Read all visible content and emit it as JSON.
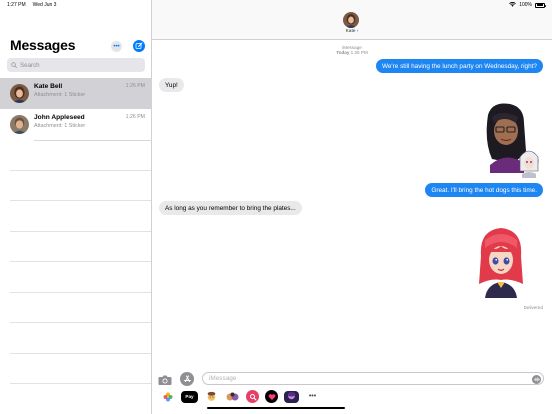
{
  "status_bar": {
    "time": "1:27 PM",
    "date": "Wed Jun 3",
    "battery": "100%"
  },
  "sidebar": {
    "title": "Messages",
    "more_symbol": "•••",
    "search_placeholder": "Search",
    "conversations": [
      {
        "name": "Kate Bell",
        "time": "1:26 PM",
        "preview": "Attachment: 1 Sticker",
        "selected": true
      },
      {
        "name": "John Appleseed",
        "time": "1:26 PM",
        "preview": "Attachment: 1 Sticker",
        "selected": false
      }
    ]
  },
  "chat": {
    "contact_name": "Kate",
    "contact_chevron": "›",
    "service": "iMessage",
    "day": "Today",
    "time": "1:25 PM",
    "messages": [
      {
        "from": "me",
        "kind": "text",
        "text": "We're still having the lunch party on Wednesday, right?"
      },
      {
        "from": "them",
        "kind": "text",
        "text": "Yup!"
      },
      {
        "from": "me",
        "kind": "sticker",
        "sticker": "dark-hair-girl-with-glasses-sticker"
      },
      {
        "from": "me",
        "kind": "text",
        "text": "Great. I'll bring the hot dogs this time."
      },
      {
        "from": "them",
        "kind": "text",
        "text": "As long as you remember to bring the plates..."
      },
      {
        "from": "me",
        "kind": "sticker",
        "sticker": "red-hair-girl-sticker"
      }
    ],
    "delivered_label": "Delivered",
    "input_placeholder": "iMessage"
  },
  "app_strip": {
    "apps": [
      "photos-app-icon",
      "apple-pay-app-icon",
      "memoji-app-icon",
      "memoji-stickers-app-icon",
      "image-search-app-icon",
      "digital-touch-app-icon",
      "sticker-pack-app-icon",
      "more-apps-icon"
    ],
    "apple_pay_label": "Pay",
    "more_label": "•••"
  },
  "colors": {
    "accent": "#007aff",
    "outgoing_bubble": "#1e86f3",
    "incoming_bubble": "#e9e9eb",
    "selected_row": "#d1d1d6"
  }
}
